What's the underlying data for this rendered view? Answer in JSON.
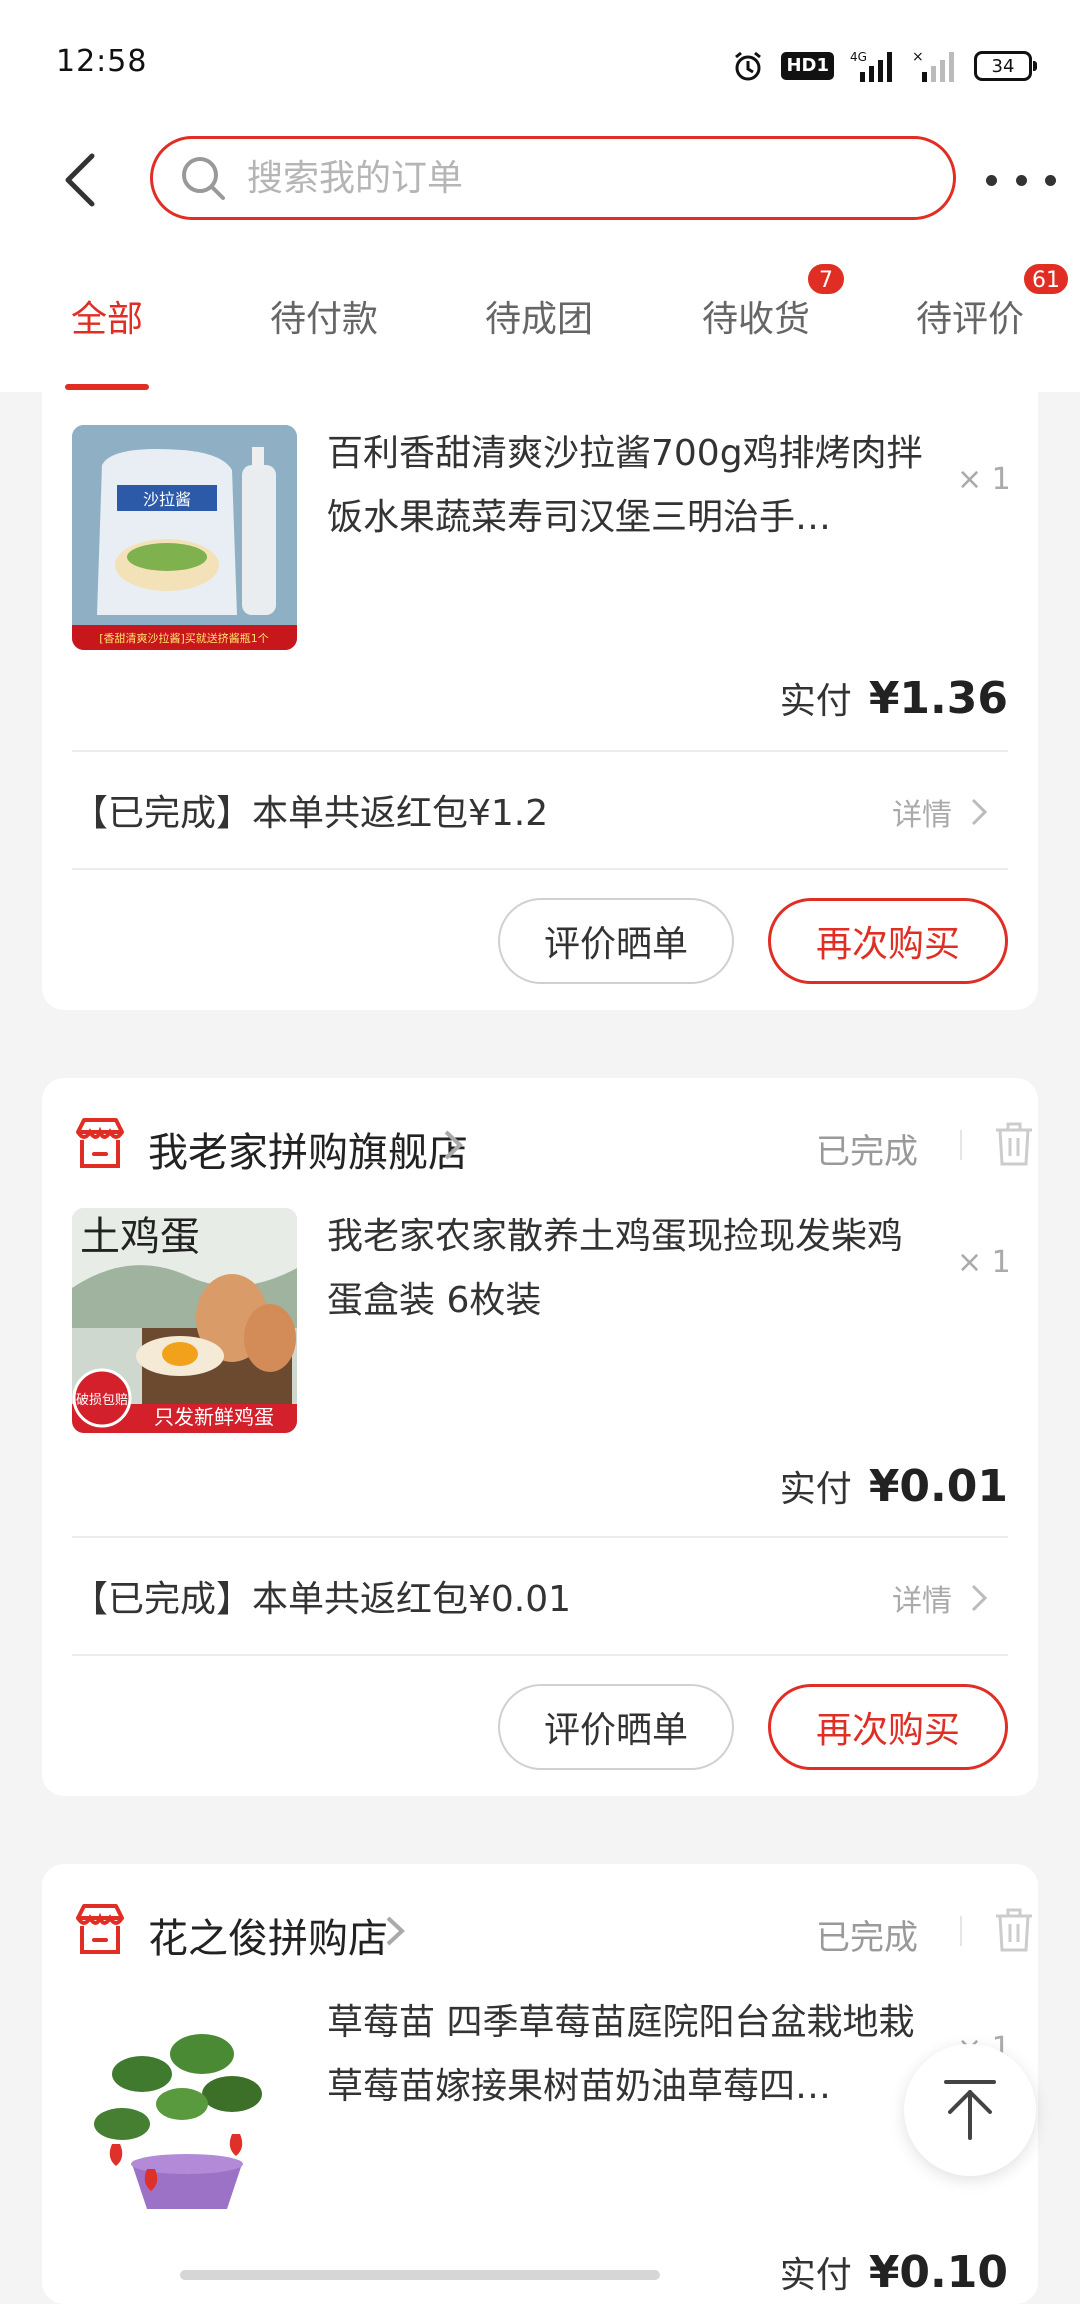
{
  "status_bar": {
    "time": "12:58",
    "hd": "HD1",
    "network": "4G",
    "battery": "34"
  },
  "search": {
    "placeholder": "搜索我的订单"
  },
  "tabs": [
    {
      "label": "全部",
      "active": true,
      "badge": ""
    },
    {
      "label": "待付款",
      "active": false,
      "badge": ""
    },
    {
      "label": "待成团",
      "active": false,
      "badge": ""
    },
    {
      "label": "待收货",
      "active": false,
      "badge": "7"
    },
    {
      "label": "待评价",
      "active": false,
      "badge": "61"
    }
  ],
  "orders": [
    {
      "shop_name": "",
      "status": "",
      "product_title": "百利香甜清爽沙拉酱700g鸡排烤肉拌饭水果蔬菜寿司汉堡三明治手…",
      "image_caption": "[香甜清爽沙拉酱]买就送挤酱瓶1个",
      "image_label": "沙拉酱",
      "quantity": "× 1",
      "paid_label": "实付",
      "paid_amount": "¥1.36",
      "refund_text": "【已完成】本单共返红包¥1.2",
      "detail_label": "详情",
      "review_button": "评价晒单",
      "rebuy_button": "再次购买"
    },
    {
      "shop_name": "我老家拼购旗舰店",
      "status": "已完成",
      "product_title": "我老家农家散养土鸡蛋现捡现发柴鸡蛋盒装 6枚装",
      "image_caption": "只发新鲜鸡蛋",
      "image_label": "土鸡蛋",
      "image_badge": "破损包赔",
      "quantity": "× 1",
      "paid_label": "实付",
      "paid_amount": "¥0.01",
      "refund_text": "【已完成】本单共返红包¥0.01",
      "detail_label": "详情",
      "review_button": "评价晒单",
      "rebuy_button": "再次购买"
    },
    {
      "shop_name": "花之俊拼购店",
      "status": "已完成",
      "product_title": "草莓苗 四季草莓苗庭院阳台盆栽地栽草莓苗嫁接果树苗奶油草莓四…",
      "quantity": "× 1",
      "paid_label": "实付",
      "paid_amount": "¥0.10"
    }
  ],
  "colors": {
    "accent": "#e02e24",
    "page_bg": "#f4f4f4"
  }
}
